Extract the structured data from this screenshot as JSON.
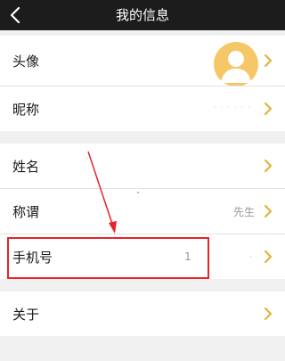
{
  "header": {
    "title": "我的信息",
    "back_icon": "chevron-left-icon"
  },
  "rows": {
    "avatar": {
      "label": "头像"
    },
    "nickname": {
      "label": "昵称",
      "value": ""
    },
    "name": {
      "label": "姓名"
    },
    "title": {
      "label": "称谓",
      "value": "先生"
    },
    "phone": {
      "label": "手机号",
      "value": "1"
    },
    "about": {
      "label": "关于"
    }
  },
  "colors": {
    "nav_bg": "#1c1c1c",
    "chevron": "#e0b43c",
    "avatar_bg": "#f6c766",
    "highlight": "#e8222a"
  }
}
